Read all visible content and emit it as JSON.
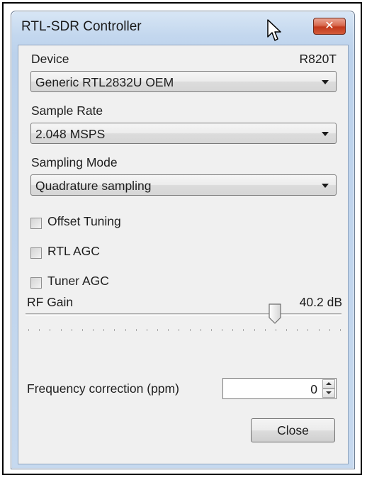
{
  "window": {
    "title": "RTL-SDR Controller",
    "close_glyph": "✕"
  },
  "device": {
    "label": "Device",
    "tuner": "R820T",
    "selected": "Generic RTL2832U OEM"
  },
  "sample_rate": {
    "label": "Sample Rate",
    "selected": "2.048 MSPS"
  },
  "sampling_mode": {
    "label": "Sampling Mode",
    "selected": "Quadrature sampling"
  },
  "checkboxes": [
    {
      "label": "Offset Tuning",
      "checked": false
    },
    {
      "label": "RTL AGC",
      "checked": false
    },
    {
      "label": "Tuner AGC",
      "checked": false
    }
  ],
  "rf_gain": {
    "label": "RF Gain",
    "value_text": "40.2 dB",
    "level": 0.79
  },
  "frequency_correction": {
    "label": "Frequency correction (ppm)",
    "value": "0"
  },
  "buttons": {
    "close_label": "Close"
  },
  "colors": {
    "close_accent": "#c2391c",
    "title_gradient_top": "#d8e6f5",
    "client_bg": "#f0f0f0"
  },
  "icons": [
    "mouse-pointer-icon",
    "close-icon",
    "chevron-down-icon",
    "spin-up-icon",
    "spin-down-icon"
  ]
}
